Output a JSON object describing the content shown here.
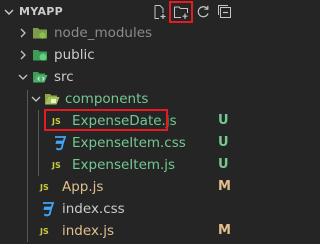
{
  "header": {
    "title": "MYAPP"
  },
  "toolbar": {
    "new_file_icon": "new-file-icon",
    "new_folder_icon": "new-folder-icon",
    "refresh_icon": "refresh-icon",
    "collapse_icon": "collapse-all-icon"
  },
  "tree": {
    "node_modules": {
      "label": "node_modules"
    },
    "public": {
      "label": "public"
    },
    "src": {
      "label": "src"
    },
    "components": {
      "label": "components"
    },
    "expense_date": {
      "label": "ExpenseDate.js",
      "status": "U"
    },
    "expense_item_css": {
      "label": "ExpenseItem.css",
      "status": "U"
    },
    "expense_item_js": {
      "label": "ExpenseItem.js",
      "status": "U"
    },
    "app_js": {
      "label": "App.js",
      "status": "M"
    },
    "index_css": {
      "label": "index.css"
    },
    "index_js": {
      "label": "index.js",
      "status": "M"
    }
  },
  "colors": {
    "untracked": "#73c991",
    "modified": "#e2c08d",
    "highlight": "#e51b23"
  }
}
